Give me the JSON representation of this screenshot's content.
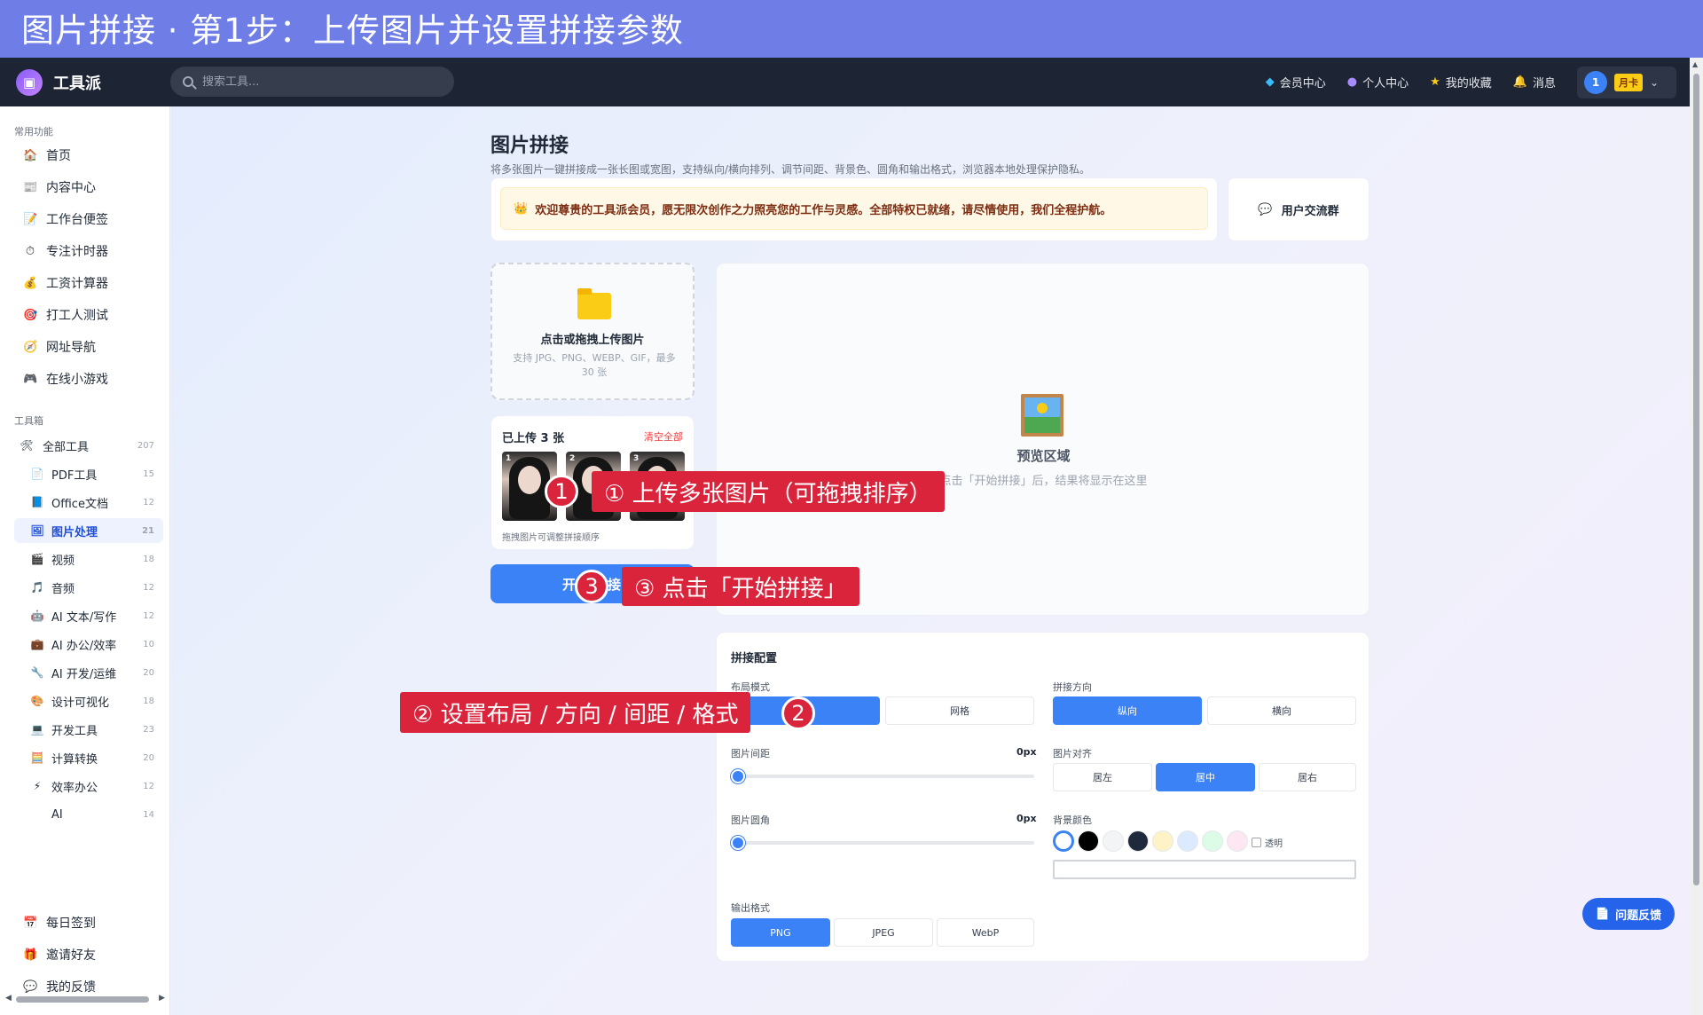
{
  "banner": {
    "title": "图片拼接 · 第1步：上传图片并设置拼接参数"
  },
  "header": {
    "app_name": "工具派",
    "search_placeholder": "搜索工具...",
    "nav": [
      {
        "label": "会员中心",
        "icon": "diamond-icon"
      },
      {
        "label": "个人中心",
        "icon": "person-icon"
      },
      {
        "label": "我的收藏",
        "icon": "star-icon"
      },
      {
        "label": "消息",
        "icon": "bell-icon"
      }
    ],
    "user": {
      "avatar_text": "1",
      "badge": "月卡"
    }
  },
  "sidebar": {
    "common_label": "常用功能",
    "common": [
      {
        "label": "首页",
        "icon": "🏠"
      },
      {
        "label": "内容中心",
        "icon": "📰"
      },
      {
        "label": "工作台便签",
        "icon": "📝"
      },
      {
        "label": "专注计时器",
        "icon": "⏱"
      },
      {
        "label": "工资计算器",
        "icon": "💰"
      },
      {
        "label": "打工人测试",
        "icon": "🎯"
      },
      {
        "label": "网址导航",
        "icon": "🧭"
      },
      {
        "label": "在线小游戏",
        "icon": "🎮"
      }
    ],
    "toolbox_label": "工具箱",
    "all_tools": {
      "label": "全部工具",
      "count": "207",
      "icon": "🛠"
    },
    "tools": [
      {
        "label": "PDF工具",
        "count": "15",
        "icon": "📄"
      },
      {
        "label": "Office文档",
        "count": "12",
        "icon": "📘"
      },
      {
        "label": "图片处理",
        "count": "21",
        "icon": "🖼"
      },
      {
        "label": "视频",
        "count": "18",
        "icon": "🎬"
      },
      {
        "label": "音频",
        "count": "12",
        "icon": "🎵"
      },
      {
        "label": "AI 文本/写作",
        "count": "12",
        "icon": "🤖"
      },
      {
        "label": "AI 办公/效率",
        "count": "10",
        "icon": "💼"
      },
      {
        "label": "AI 开发/运维",
        "count": "20",
        "icon": "🔧"
      },
      {
        "label": "设计可视化",
        "count": "18",
        "icon": "🎨"
      },
      {
        "label": "开发工具",
        "count": "23",
        "icon": "💻"
      },
      {
        "label": "计算转换",
        "count": "20",
        "icon": "🧮"
      },
      {
        "label": "效率办公",
        "count": "12",
        "icon": "⚡"
      },
      {
        "label": "AI",
        "count": "14",
        "icon": ""
      }
    ],
    "bottom": [
      {
        "label": "每日签到",
        "icon": "📅"
      },
      {
        "label": "邀请好友",
        "icon": "🎁"
      },
      {
        "label": "我的反馈",
        "icon": "💬"
      }
    ]
  },
  "page": {
    "title": "图片拼接",
    "subtitle": "将多张图片一键拼接成一张长图或宽图，支持纵向/横向排列、调节间距、背景色、圆角和输出格式，浏览器本地处理保护隐私。",
    "notice": "欢迎尊贵的工具派会员，愿无限次创作之力照亮您的工作与灵感。全部特权已就绪，请尽情使用，我们全程护航。",
    "group_button": "用户交流群"
  },
  "upload": {
    "title": "点击或拖拽上传图片",
    "hint": "支持 JPG、PNG、WEBP、GIF，最多 30 张"
  },
  "uploaded": {
    "title": "已上传 3 张",
    "clear": "清空全部",
    "thumbs": [
      "1",
      "2",
      "3"
    ],
    "drag_hint": "拖拽图片可调整拼接顺序"
  },
  "start_button": "开始拼接",
  "preview": {
    "title": "预览区域",
    "subtitle": "点击「开始拼接」后，结果将显示在这里"
  },
  "config": {
    "title": "拼接配置",
    "layout_label": "布局模式",
    "layout_options": [
      "",
      "网格"
    ],
    "layout_selected": 0,
    "direction_label": "拼接方向",
    "direction_options": [
      "纵向",
      "横向"
    ],
    "gap_label": "图片间距",
    "gap_value": "0px",
    "align_label": "图片对齐",
    "align_options": [
      "居左",
      "居中",
      "居右"
    ],
    "radius_label": "图片圆角",
    "radius_value": "0px",
    "bg_label": "背景颜色",
    "bg_colors": [
      "#ffffff",
      "#000000",
      "#f3f4f6",
      "#1e293b",
      "#fef3c7",
      "#dbeafe",
      "#dcfce7",
      "#fce7f3"
    ],
    "transparent_label": "透明",
    "format_label": "输出格式",
    "format_options": [
      "PNG",
      "JPEG",
      "WebP"
    ]
  },
  "feedback_button": "问题反馈",
  "annotations": {
    "step1": "① 上传多张图片（可拖拽排序）",
    "step2": "② 设置布局 / 方向 / 间距 / 格式",
    "step3": "③ 点击「开始拼接」",
    "m1": "1",
    "m2": "2",
    "m3": "3"
  }
}
